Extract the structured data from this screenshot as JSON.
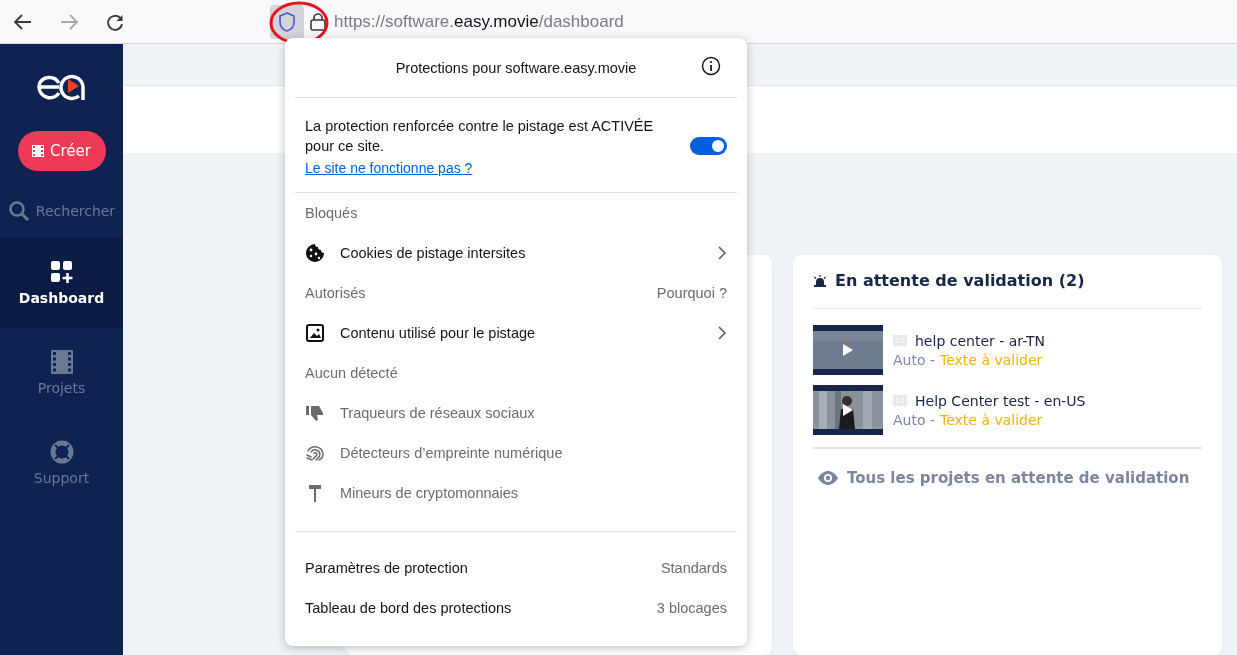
{
  "browser": {
    "url_scheme": "https://software.",
    "url_domain": "easy.movie",
    "url_path": "/dashboard"
  },
  "sidebar": {
    "create_button": "Créer",
    "search": "Rechercher",
    "items": [
      {
        "label": "Dashboard",
        "selected": true
      },
      {
        "label": "Projets",
        "selected": false
      },
      {
        "label": "Support",
        "selected": false
      }
    ]
  },
  "validation_card": {
    "title": "En attente de validation (2)",
    "items": [
      {
        "title": "help center - ar-TN",
        "mode": "Auto -",
        "status": "Texte à valider"
      },
      {
        "title": "Help Center test - en-US",
        "mode": "Auto -",
        "status": "Texte à valider"
      }
    ],
    "link": "Tous les projets en attente de validation"
  },
  "popup": {
    "title": "Protections pour software.easy.movie",
    "tracking": {
      "message": "La protection renforcée contre le pistage est ACTIVÉE pour ce site.",
      "link": "Le site ne fonctionne pas ?",
      "on": true
    },
    "sections": [
      {
        "heading": "Bloqués",
        "items": [
          {
            "label": "Cookies de pistage intersites",
            "kind": "detail"
          }
        ]
      },
      {
        "heading": "Autorisés",
        "aside": "Pourquoi ?",
        "items": [
          {
            "label": "Contenu utilisé pour le pistage",
            "kind": "detail"
          }
        ]
      },
      {
        "heading": "Aucun détecté",
        "items": [
          {
            "label": "Traqueurs de réseaux sociaux",
            "kind": "none"
          },
          {
            "label": "Détecteurs d’empreinte numérique",
            "kind": "none"
          },
          {
            "label": "Mineurs de cryptomonnaies",
            "kind": "none"
          }
        ]
      }
    ],
    "footer": [
      {
        "label": "Paramètres de protection",
        "value": "Standards"
      },
      {
        "label": "Tableau de bord des protections",
        "value": "3 blocages"
      }
    ]
  }
}
